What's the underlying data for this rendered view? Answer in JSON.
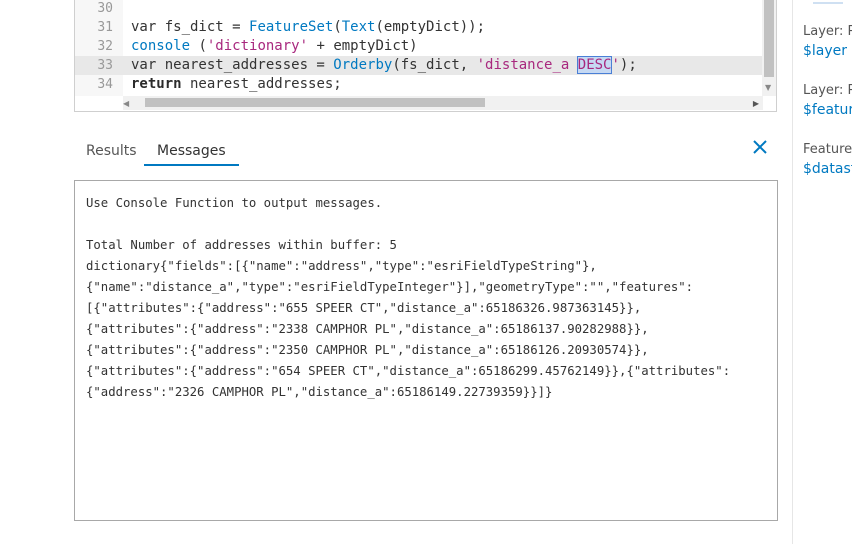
{
  "editor": {
    "lines": [
      {
        "num": "30",
        "tokens": []
      },
      {
        "num": "31",
        "tokens": [
          {
            "t": "var fs_dict = ",
            "c": ""
          },
          {
            "t": "FeatureSet",
            "c": "fn"
          },
          {
            "t": "(",
            "c": ""
          },
          {
            "t": "Text",
            "c": "fn"
          },
          {
            "t": "(emptyDict));",
            "c": ""
          }
        ]
      },
      {
        "num": "32",
        "tokens": [
          {
            "t": "console",
            "c": "fn"
          },
          {
            "t": " (",
            "c": ""
          },
          {
            "t": "'dictionary'",
            "c": "str"
          },
          {
            "t": " + emptyDict)",
            "c": ""
          }
        ]
      },
      {
        "num": "33",
        "active": true,
        "tokens": [
          {
            "t": "var nearest_addresses = ",
            "c": ""
          },
          {
            "t": "Orderby",
            "c": "fn"
          },
          {
            "t": "(fs_dict, ",
            "c": ""
          },
          {
            "t": "'distance_a ",
            "c": "str"
          },
          {
            "t": "DESC",
            "c": "str sel"
          },
          {
            "t": "'",
            "c": "str"
          },
          {
            "t": ");",
            "c": ""
          }
        ]
      },
      {
        "num": "34",
        "tokens": [
          {
            "t": "return",
            "c": "kw"
          },
          {
            "t": " nearest_addresses;",
            "c": ""
          }
        ]
      }
    ]
  },
  "tabs": {
    "results": "Results",
    "messages": "Messages"
  },
  "messages": {
    "lines": [
      "Use Console Function to output messages.",
      "",
      "Total Number of addresses within buffer: 5",
      "dictionary{\"fields\":[{\"name\":\"address\",\"type\":\"esriFieldTypeString\"},",
      "{\"name\":\"distance_a\",\"type\":\"esriFieldTypeInteger\"}],\"geometryType\":\"\",\"features\":",
      "[{\"attributes\":{\"address\":\"655 SPEER CT\",\"distance_a\":65186326.987363145}},",
      "{\"attributes\":{\"address\":\"2338 CAMPHOR PL\",\"distance_a\":65186137.90282988}},",
      "{\"attributes\":{\"address\":\"2350 CAMPHOR PL\",\"distance_a\":65186126.20930574}},",
      "{\"attributes\":{\"address\":\"654 SPEER CT\",\"distance_a\":65186299.45762149}},{\"attributes\":",
      "{\"address\":\"2326 CAMPHOR PL\",\"distance_a\":65186149.22739359}}]}"
    ]
  },
  "right_panel": {
    "items": [
      {
        "label": "Layer: P",
        "value": "$layer"
      },
      {
        "label": "Layer: P",
        "value": "$feature"
      },
      {
        "label": "Feature",
        "value": "$datasto"
      }
    ]
  },
  "colors": {
    "accent": "#0079c1",
    "string": "#a8287e",
    "selection": "#c6d9f3"
  },
  "icons": {
    "close": "close-icon"
  }
}
